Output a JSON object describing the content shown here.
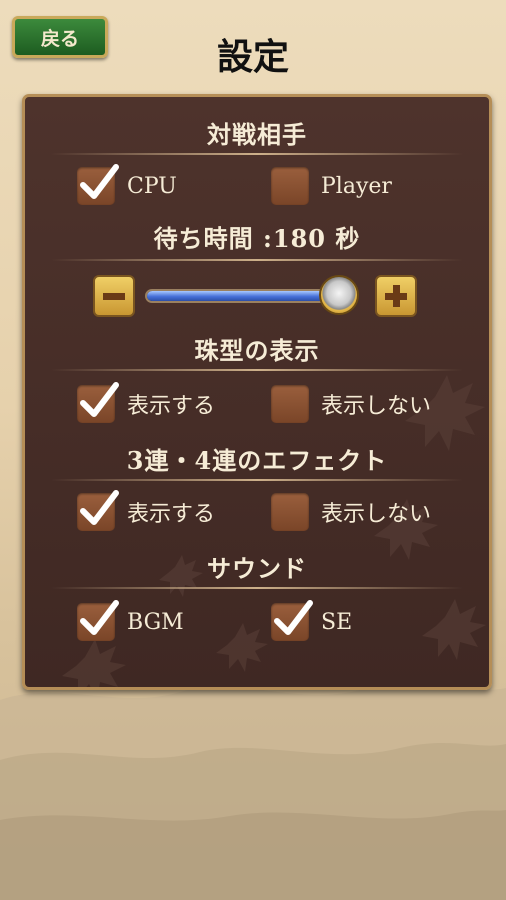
{
  "header": {
    "back_label": "戻る",
    "title": "設定"
  },
  "opponent": {
    "title": "対戦相手",
    "options": [
      {
        "label": "CPU",
        "checked": true
      },
      {
        "label": "Player",
        "checked": false
      }
    ]
  },
  "wait_time": {
    "title": "待ち時間 :180 秒",
    "value_seconds": 180,
    "slider_level": 0.94
  },
  "bead_display": {
    "title": "珠型の表示",
    "options": [
      {
        "label": "表示する",
        "checked": true
      },
      {
        "label": "表示しない",
        "checked": false
      }
    ]
  },
  "chain_effect": {
    "title": "3連・4連のエフェクト",
    "options": [
      {
        "label": "表示する",
        "checked": true
      },
      {
        "label": "表示しない",
        "checked": false
      }
    ]
  },
  "sound": {
    "title": "サウンド",
    "options": [
      {
        "label": "BGM",
        "checked": true
      },
      {
        "label": "SE",
        "checked": true
      }
    ]
  },
  "icons": {
    "checkmark": "checkmark-icon",
    "minus": "minus-icon",
    "plus": "plus-icon"
  },
  "colors": {
    "panel": "#4a302a",
    "check": "#ffffff",
    "back_button": "#2c6e2e",
    "slider_fill": "#4670d8"
  }
}
